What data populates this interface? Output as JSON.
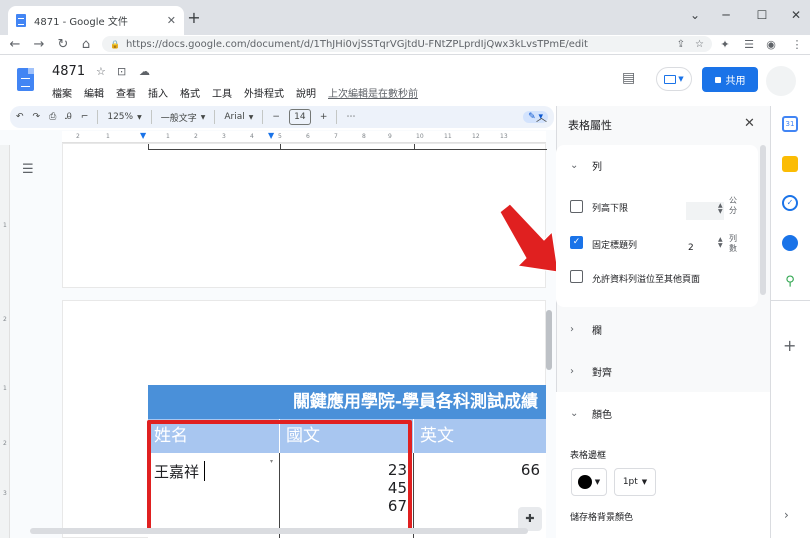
{
  "browser": {
    "tab_title": "4871 - Google 文件",
    "url": "https://docs.google.com/document/d/1ThJHi0vjSSTqrVGjtdU-FNtZPLprdIjQwx3kLvsTPmE/edit"
  },
  "doc": {
    "title": "4871",
    "share_label": "共用",
    "menus": [
      "檔案",
      "編輯",
      "查看",
      "插入",
      "格式",
      "工具",
      "外掛程式",
      "說明"
    ],
    "last_edit": "上次編輯是在數秒前"
  },
  "toolbar": {
    "zoom": "125%",
    "style": "一般文字",
    "font": "Arial",
    "font_size": "14"
  },
  "ruler": {
    "ticks": [
      "2",
      "1",
      "1",
      "2",
      "3",
      "4",
      "5",
      "6",
      "7",
      "8",
      "9",
      "10",
      "11",
      "12",
      "13"
    ]
  },
  "vruler": {
    "ticks": [
      "1",
      "2",
      "1",
      "2",
      "3"
    ]
  },
  "table": {
    "title": "關鍵應用學院-學員各科測試成績",
    "headers": [
      "姓名",
      "國文",
      "英文"
    ],
    "row": {
      "name": "王嘉祥",
      "chinese_scores": [
        "23",
        "45",
        "67"
      ],
      "english_score": "66"
    }
  },
  "panel": {
    "title": "表格屬性",
    "sections": {
      "row": "列",
      "column": "欄",
      "alignment": "對齊",
      "color": "顏色"
    },
    "row_options": {
      "min_height_label": "列高下限",
      "min_height_unit": "公分",
      "pin_header_label": "固定標題列",
      "pin_header_value": "2",
      "pin_header_unit": "列數",
      "overflow_label": "允許資料列溢位至其他頁面"
    },
    "color_options": {
      "border_label": "表格邊框",
      "border_width": "1pt",
      "bg_label": "儲存格背景顏色"
    }
  },
  "colors": {
    "title_bg": "#4a90d9",
    "header_bg": "#a8c6f0",
    "highlight": "#e02020",
    "accent": "#1a73e8"
  }
}
